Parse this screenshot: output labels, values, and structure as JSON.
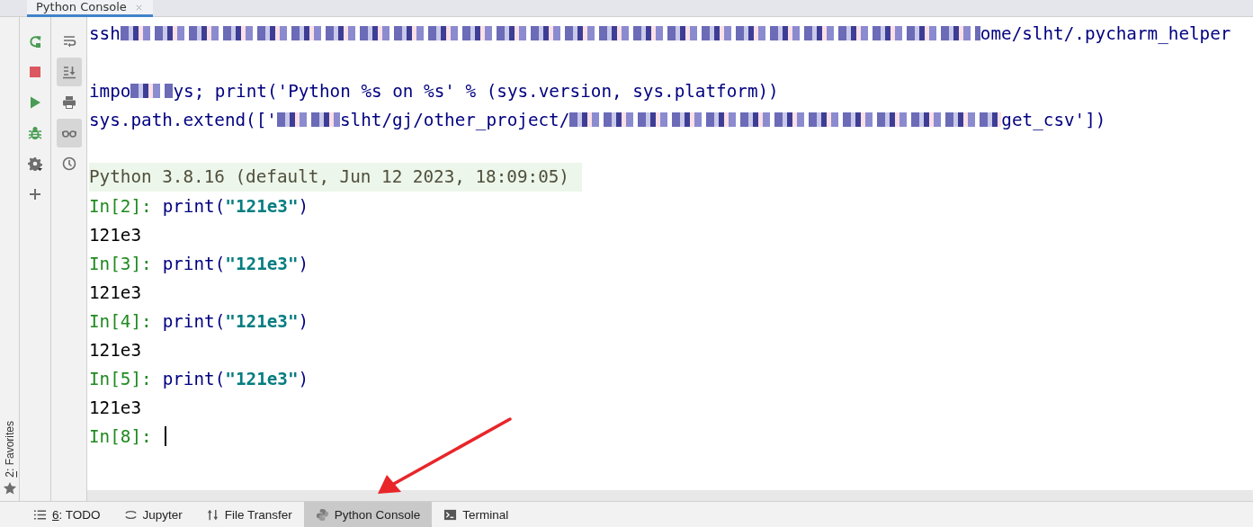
{
  "tabs": [
    {
      "label": "Python Console",
      "selected": true
    }
  ],
  "side_stripe": {
    "mnemonic": "2",
    "label": ": Favorites"
  },
  "toolbar_left": [
    {
      "kind": "rerun"
    },
    {
      "kind": "stop"
    },
    {
      "kind": "run"
    },
    {
      "kind": "debug"
    },
    {
      "kind": "settings"
    },
    {
      "kind": "add"
    }
  ],
  "toolbar_right": [
    {
      "kind": "wrap",
      "selected": false
    },
    {
      "kind": "scroll-end",
      "selected": true
    },
    {
      "kind": "print",
      "selected": false
    },
    {
      "kind": "glasses",
      "selected": true
    },
    {
      "kind": "history",
      "selected": false
    }
  ],
  "console_lines": [
    {
      "kind": "command",
      "segments": [
        {
          "kind": "text",
          "text": "ssh"
        },
        {
          "kind": "redacted"
        },
        {
          "kind": "text",
          "text": "ome/slht/.pycharm_helper"
        }
      ]
    },
    {
      "kind": "blank"
    },
    {
      "kind": "command",
      "segments": [
        {
          "kind": "text",
          "text": "impo"
        },
        {
          "kind": "redacted"
        },
        {
          "kind": "text",
          "text": "ys; print('Python %s on %s' % (sys.version, sys.platform))"
        }
      ]
    },
    {
      "kind": "command",
      "segments": [
        {
          "kind": "text",
          "text": "sys.path.extend(['"
        },
        {
          "kind": "redacted"
        },
        {
          "kind": "text",
          "text": "slht/gj/other_project/"
        },
        {
          "kind": "redacted"
        },
        {
          "kind": "text",
          "text": "get_csv'])"
        }
      ]
    },
    {
      "kind": "blank"
    },
    {
      "kind": "banner",
      "text": "Python 3.8.16 (default, Jun 12 2023, 18:09:05)"
    },
    {
      "kind": "input",
      "prompt": "In[2]:",
      "code": [
        {
          "kind": "plain",
          "text": "print("
        },
        {
          "kind": "string",
          "text": "\"121e3\""
        },
        {
          "kind": "plain",
          "text": ")"
        }
      ]
    },
    {
      "kind": "output",
      "text": "121e3"
    },
    {
      "kind": "input",
      "prompt": "In[3]:",
      "code": [
        {
          "kind": "plain",
          "text": "print("
        },
        {
          "kind": "string",
          "text": "\"121e3\""
        },
        {
          "kind": "plain",
          "text": ")"
        }
      ]
    },
    {
      "kind": "output",
      "text": "121e3"
    },
    {
      "kind": "input",
      "prompt": "In[4]:",
      "code": [
        {
          "kind": "plain",
          "text": "print("
        },
        {
          "kind": "string",
          "text": "\"121e3\""
        },
        {
          "kind": "plain",
          "text": ")"
        }
      ]
    },
    {
      "kind": "output",
      "text": "121e3"
    },
    {
      "kind": "input",
      "prompt": "In[5]:",
      "code": [
        {
          "kind": "plain",
          "text": "print("
        },
        {
          "kind": "string",
          "text": "\"121e3\""
        },
        {
          "kind": "plain",
          "text": ")"
        }
      ]
    },
    {
      "kind": "output",
      "text": "121e3"
    },
    {
      "kind": "input",
      "prompt": "In[8]:",
      "cursor": true
    }
  ],
  "tool_windows": [
    {
      "kind": "list",
      "mnemonic": "6",
      "label": ": TODO",
      "selected": false
    },
    {
      "kind": "jupyter",
      "label": "Jupyter",
      "selected": false
    },
    {
      "kind": "transfer",
      "label": "File Transfer",
      "selected": false
    },
    {
      "kind": "python",
      "label": "Python Console",
      "selected": true
    },
    {
      "kind": "terminal",
      "label": "Terminal",
      "selected": false
    }
  ]
}
